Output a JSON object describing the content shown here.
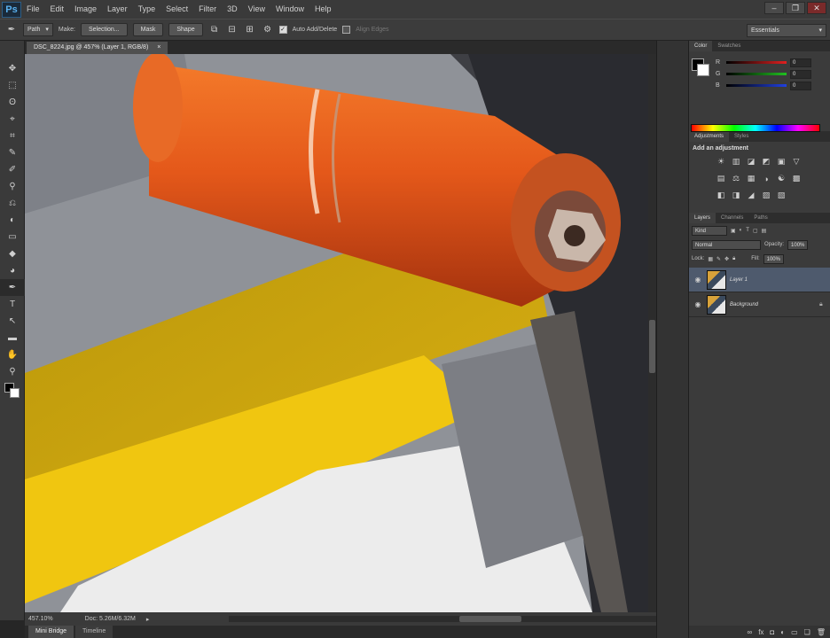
{
  "app": {
    "logo": "Ps"
  },
  "menu": [
    "File",
    "Edit",
    "Image",
    "Layer",
    "Type",
    "Select",
    "Filter",
    "3D",
    "View",
    "Window",
    "Help"
  ],
  "window_controls": {
    "minimize": "–",
    "restore": "❐",
    "close": "✕"
  },
  "options": {
    "mode": "Path",
    "make_label": "Make:",
    "selection_btn": "Selection...",
    "mask_btn": "Mask",
    "shape_btn": "Shape",
    "auto_add_delete": "Auto Add/Delete",
    "align_edges": "Align Edges",
    "workspace": "Essentials"
  },
  "document": {
    "tab_title": "DSC_8224.jpg @ 457% (Layer 1, RGB/8)",
    "tab_close": "×",
    "zoom": "457.10%",
    "doc_size": "Doc: 5.26M/6.32M"
  },
  "bottom_tabs": [
    "Mini Bridge",
    "Timeline"
  ],
  "color_panel": {
    "tabs": [
      "Color",
      "Swatches"
    ],
    "channels": [
      {
        "label": "R",
        "value": "0",
        "gradient": "#e02020"
      },
      {
        "label": "G",
        "value": "0",
        "gradient": "#20c020"
      },
      {
        "label": "B",
        "value": "0",
        "gradient": "#2040e0"
      }
    ]
  },
  "adjustments_panel": {
    "tabs": [
      "Adjustments",
      "Styles"
    ],
    "title": "Add an adjustment",
    "rows": [
      [
        "☀",
        "▥",
        "◪",
        "◩",
        "▣",
        "▽"
      ],
      [
        "▤",
        "⚖",
        "▦",
        "◑",
        "☯",
        "▩"
      ],
      [
        "◧",
        "◨",
        "◢",
        "▨",
        "▧"
      ]
    ]
  },
  "layers_panel": {
    "tabs": [
      "Layers",
      "Channels",
      "Paths"
    ],
    "kind": "Kind",
    "blend_mode": "Normal",
    "opacity_label": "Opacity:",
    "opacity": "100%",
    "lock_label": "Lock:",
    "fill_label": "Fill:",
    "fill": "100%",
    "layers": [
      {
        "name": "Layer 1",
        "selected": true
      },
      {
        "name": "Background",
        "selected": false
      }
    ]
  },
  "tools": [
    "✥",
    "⬚",
    "ʘ",
    "⌖",
    "⌗",
    "✎",
    "✐",
    "⚲",
    "⎌",
    "◐",
    "▭",
    "◆",
    "◕",
    "✒",
    "T",
    "↖",
    "▬",
    "✋",
    "⚲"
  ]
}
